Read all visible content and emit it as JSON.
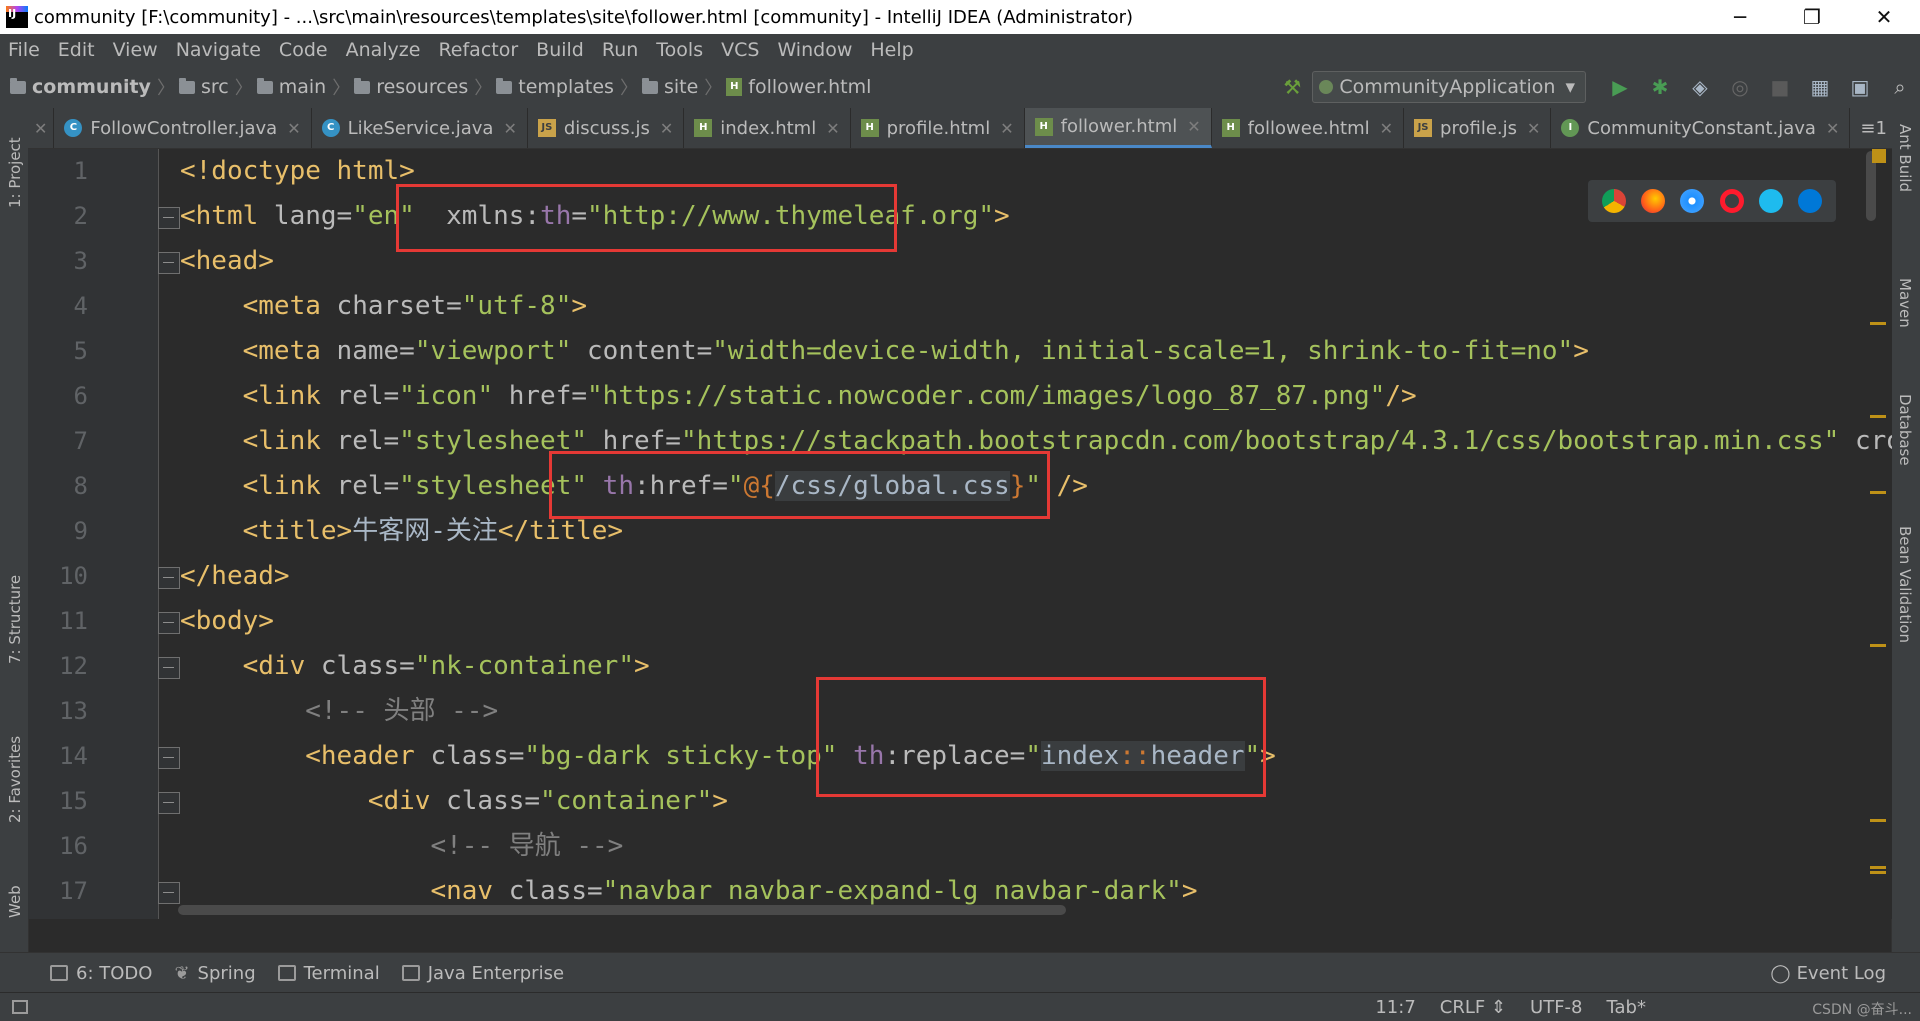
{
  "window": {
    "title": "community [F:\\community] - ...\\src\\main\\resources\\templates\\site\\follower.html [community] - IntelliJ IDEA (Administrator)",
    "minimize": "─",
    "maximize": "❐",
    "close": "✕"
  },
  "menu": [
    "File",
    "Edit",
    "View",
    "Navigate",
    "Code",
    "Analyze",
    "Refactor",
    "Build",
    "Run",
    "Tools",
    "VCS",
    "Window",
    "Help"
  ],
  "breadcrumb": [
    "community",
    "src",
    "main",
    "resources",
    "templates",
    "site",
    "follower.html"
  ],
  "run_config": "CommunityApplication",
  "tabs": [
    {
      "label": "FollowController.java",
      "type": "c"
    },
    {
      "label": "LikeService.java",
      "type": "c"
    },
    {
      "label": "discuss.js",
      "type": "j"
    },
    {
      "label": "index.html",
      "type": "h"
    },
    {
      "label": "profile.html",
      "type": "h"
    },
    {
      "label": "follower.html",
      "type": "h",
      "active": true
    },
    {
      "label": "followee.html",
      "type": "h"
    },
    {
      "label": "profile.js",
      "type": "j"
    },
    {
      "label": "CommunityConstant.java",
      "type": "i"
    }
  ],
  "tabs_more": "≡1",
  "left_tools": [
    "1: Project",
    "7: Structure",
    "2: Favorites",
    "Web"
  ],
  "right_tools": [
    "Ant Build",
    "Maven",
    "Database",
    "Bean Validation"
  ],
  "line_numbers": [
    "1",
    "2",
    "3",
    "4",
    "5",
    "6",
    "7",
    "8",
    "9",
    "10",
    "11",
    "12",
    "13",
    "14",
    "15",
    "16",
    "17"
  ],
  "code": {
    "l1": "<!doctype html>",
    "l2_open": "<html ",
    "l2_attr1": "lang=",
    "l2_val1": "\"en\"",
    "l2_ns": "xmlns:",
    "l2_th": "th",
    "l2_eq": "=",
    "l2_val2": "\"http://www.thymeleaf.org\"",
    "l2_close": ">",
    "l3": "<head>",
    "l4_tag": "<meta ",
    "l4_attr": "charset=",
    "l4_val": "\"utf-8\"",
    "l4_end": ">",
    "l5_tag": "<meta ",
    "l5_attr1": "name=",
    "l5_val1": "\"viewport\"",
    "l5_attr2": " content=",
    "l5_val2": "\"width=device-width, initial-scale=1, shrink-to-fit=no\"",
    "l5_end": ">",
    "l6_tag": "<link ",
    "l6_attr1": "rel=",
    "l6_val1": "\"icon\"",
    "l6_attr2": " href=",
    "l6_val2": "\"https://static.nowcoder.com/images/logo_87_87.png\"",
    "l6_end": "/>",
    "l7_tag": "<link ",
    "l7_attr1": "rel=",
    "l7_val1": "\"stylesheet\"",
    "l7_attr2": " href=",
    "l7_val2": "\"https://stackpath.bootstrapcdn.com/bootstrap/4.3.1/css/bootstrap.min.css\"",
    "l7_attr3": " crossor",
    "l8_tag": "<link ",
    "l8_attr1": "rel=",
    "l8_val1": "\"stylesheet\"",
    "l8_th": " th",
    "l8_attr2": ":href=",
    "l8_q1": "\"",
    "l8_at": "@{",
    "l8_path": "/css/global.css",
    "l8_brace": "}",
    "l8_q2": "\"",
    "l8_end": " />",
    "l9_open": "<title>",
    "l9_text": "牛客网-关注",
    "l9_close": "</title>",
    "l10": "</head>",
    "l11": "<body>",
    "l12_tag": "<div ",
    "l12_attr": "class=",
    "l12_val": "\"nk-container\"",
    "l12_end": ">",
    "l13": "<!-- 头部 -->",
    "l14_tag": "<header ",
    "l14_attr": "class=",
    "l14_val": "\"bg-dark sticky-top\"",
    "l14_th": " th",
    "l14_attr2": ":replace=",
    "l14_q1": "\"",
    "l14_ref1": "index",
    "l14_sep": "::",
    "l14_ref2": "header",
    "l14_q2": "\"",
    "l14_end": ">",
    "l15_tag": "<div ",
    "l15_attr": "class=",
    "l15_val": "\"container\"",
    "l15_end": ">",
    "l16": "<!-- 导航 -->",
    "l17_tag": "<nav ",
    "l17_attr": "class=",
    "l17_val": "\"navbar navbar-expand-lg navbar-dark\"",
    "l17_end": ">"
  },
  "bottom_tools": [
    "6: TODO",
    "Spring",
    "Terminal",
    "Java Enterprise"
  ],
  "event_log": "Event Log",
  "status": {
    "position": "11:7",
    "line_sep": "CRLF ⇕",
    "encoding": "UTF-8",
    "indent": "Tab*"
  },
  "watermark": "CSDN @奋斗..."
}
